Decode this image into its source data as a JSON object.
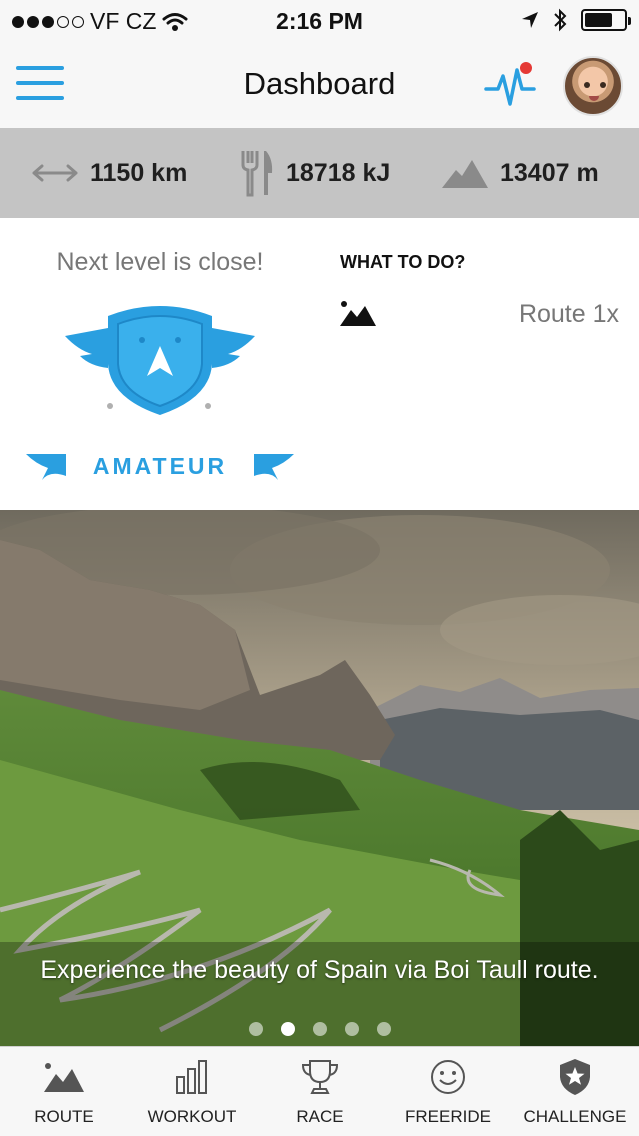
{
  "status_bar": {
    "carrier": "VF CZ",
    "time": "2:16 PM",
    "battery_level": 0.7
  },
  "nav": {
    "title": "Dashboard"
  },
  "stats": [
    {
      "icon": "distance-arrows-icon",
      "value": "1150 km"
    },
    {
      "icon": "fork-knife-icon",
      "value": "18718 kJ"
    },
    {
      "icon": "mountain-icon",
      "value": "13407 m"
    }
  ],
  "level": {
    "message": "Next level is close!",
    "name": "AMATEUR"
  },
  "todo": {
    "title": "WHAT TO DO?",
    "items": [
      {
        "icon": "route-mountain-icon",
        "text": "Route 1x"
      }
    ]
  },
  "hero": {
    "caption": "Experience the beauty of Spain via Boi Taull route.",
    "page_count": 5,
    "active_page": 2
  },
  "tabs": [
    {
      "label": "ROUTE",
      "icon": "mountain-icon"
    },
    {
      "label": "WORKOUT",
      "icon": "bar-chart-icon"
    },
    {
      "label": "RACE",
      "icon": "trophy-icon"
    },
    {
      "label": "FREERIDE",
      "icon": "smiley-icon"
    },
    {
      "label": "CHALLENGE",
      "icon": "shield-star-icon"
    }
  ],
  "colors": {
    "accent": "#2a9fe0",
    "notification": "#e53935",
    "stats_background": "#c4c4c4"
  }
}
